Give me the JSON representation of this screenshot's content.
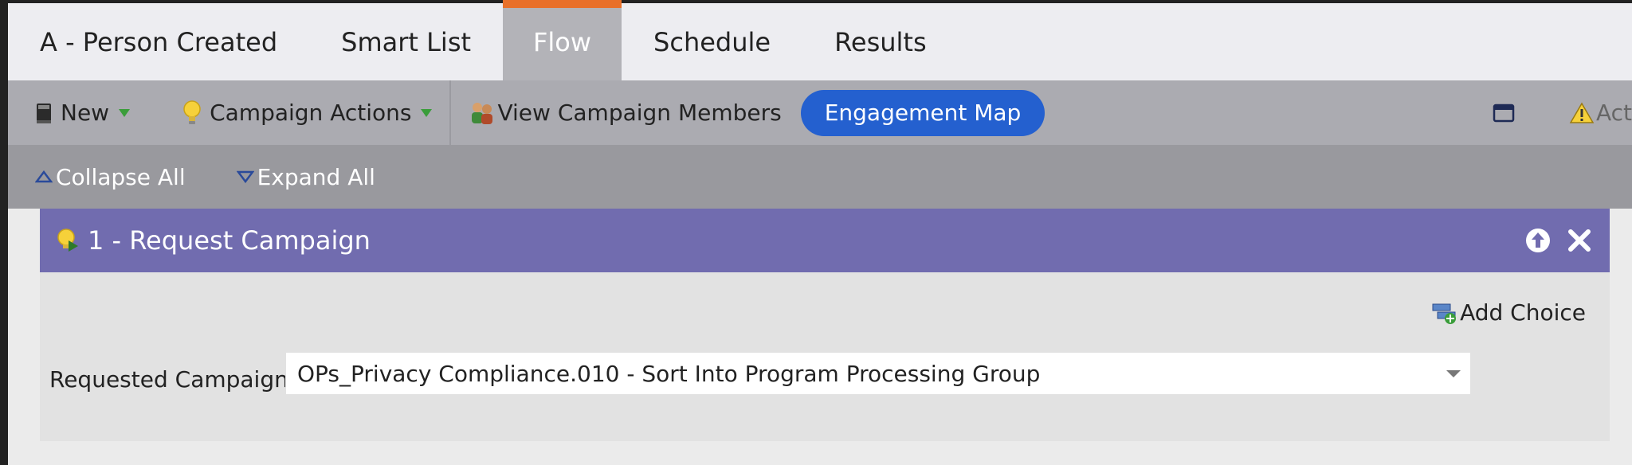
{
  "tabs": {
    "items": [
      {
        "label": "A - Person Created"
      },
      {
        "label": "Smart List"
      },
      {
        "label": "Flow"
      },
      {
        "label": "Schedule"
      },
      {
        "label": "Results"
      }
    ],
    "active_index": 2
  },
  "toolbar": {
    "new_label": "New",
    "campaign_actions_label": "Campaign Actions",
    "view_members_label": "View Campaign Members",
    "engagement_map_label": "Engagement Map",
    "right_partial_label": "Act"
  },
  "collapse_row": {
    "collapse_label": "Collapse All",
    "expand_label": "Expand All"
  },
  "panel": {
    "title": "1 - Request Campaign",
    "add_choice_label": "Add Choice",
    "requested_campaign_label": "Requested Campaign:",
    "requested_campaign_value": "OPs_Privacy Compliance.010 - Sort Into Program Processing Group"
  },
  "colors": {
    "active_tab_accent": "#e8702a",
    "engagement_map_button": "#2460cf",
    "panel_header": "#716caf"
  },
  "icons": {
    "new": "book-icon",
    "campaign_actions": "lightbulb-icon",
    "view_members": "people-icon",
    "window": "window-icon",
    "alert": "warning-icon",
    "panel": "lightbulb-play-icon",
    "move_up": "arrow-up-circle-icon",
    "remove": "close-icon",
    "add_choice": "add-choice-icon"
  }
}
